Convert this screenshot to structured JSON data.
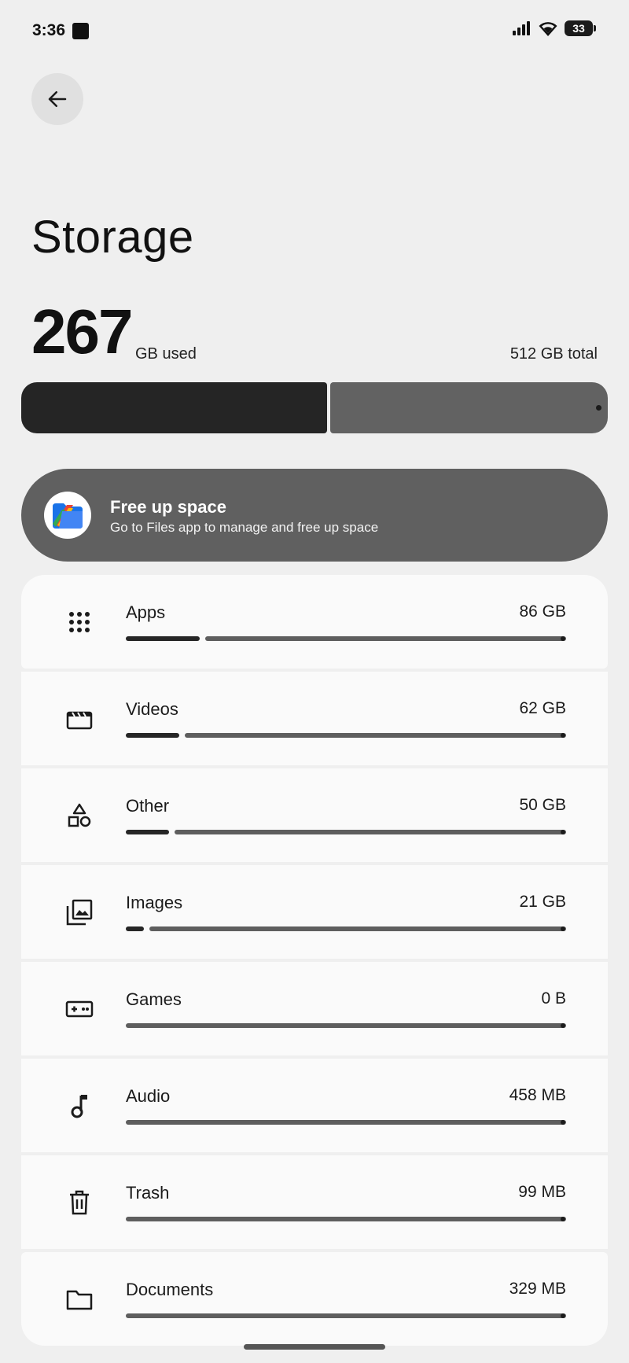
{
  "status_bar": {
    "time": "3:36",
    "battery": "33"
  },
  "page": {
    "title": "Storage"
  },
  "summary": {
    "used_value": "267",
    "used_unit": "GB used",
    "total": "512 GB total",
    "used_fraction": 0.521
  },
  "free_up": {
    "title": "Free up space",
    "subtitle": "Go to Files app to manage and free up space"
  },
  "categories": [
    {
      "label": "Apps",
      "value": "86 GB",
      "fraction": 0.168,
      "icon": "apps-grid-icon"
    },
    {
      "label": "Videos",
      "value": "62 GB",
      "fraction": 0.121,
      "icon": "video-clapper-icon"
    },
    {
      "label": "Other",
      "value": "50 GB",
      "fraction": 0.098,
      "icon": "shapes-icon"
    },
    {
      "label": "Images",
      "value": "21 GB",
      "fraction": 0.041,
      "icon": "image-gallery-icon"
    },
    {
      "label": "Games",
      "value": "0 B",
      "fraction": 0,
      "icon": "gamepad-icon"
    },
    {
      "label": "Audio",
      "value": "458 MB",
      "fraction": 0,
      "icon": "music-note-icon"
    },
    {
      "label": "Trash",
      "value": "99 MB",
      "fraction": 0,
      "icon": "trash-icon"
    },
    {
      "label": "Documents",
      "value": "329 MB",
      "fraction": 0,
      "icon": "folder-icon"
    }
  ],
  "colors": {
    "background": "#efefef",
    "used_dark": "#252525",
    "free_gray": "#626262",
    "card_bg": "#fafafa"
  }
}
